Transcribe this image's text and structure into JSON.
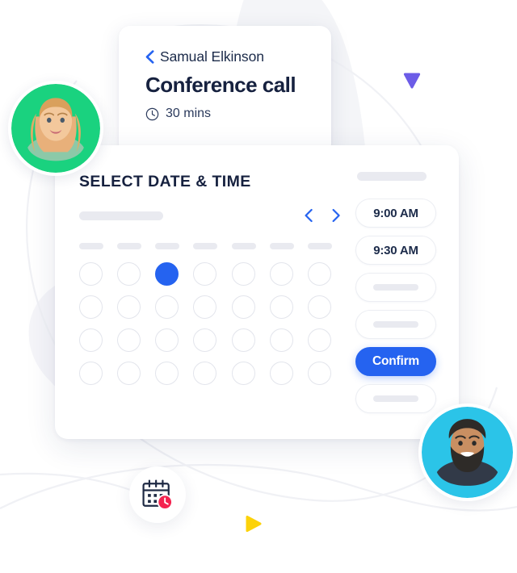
{
  "meeting": {
    "back_icon": "chevron-left-icon",
    "host_name": "Samual Elkinson",
    "title": "Conference call",
    "clock_icon": "clock-icon",
    "duration": "30 mins"
  },
  "picker": {
    "heading": "SELECT DATE & TIME",
    "calendar": {
      "month_label": "",
      "prev_icon": "chevron-left-icon",
      "next_icon": "chevron-right-icon",
      "weekday_count": 7,
      "rows": 4,
      "selected_row": 0,
      "selected_col": 2,
      "last_row_visible_cols": 7
    },
    "slots": [
      {
        "label": "9:00 AM",
        "style": "text",
        "selected": false
      },
      {
        "label": "9:30 AM",
        "style": "text",
        "selected": false
      },
      {
        "label": "",
        "style": "skeleton",
        "selected": false
      },
      {
        "label": "",
        "style": "skeleton",
        "selected": false
      },
      {
        "label": "Confirm",
        "style": "primary",
        "selected": true
      },
      {
        "label": "",
        "style": "skeleton",
        "selected": false
      }
    ]
  },
  "decor": {
    "avatar_left": {
      "name": "avatar-woman",
      "bg": "#1ad27f"
    },
    "avatar_right": {
      "name": "avatar-man",
      "bg": "#2bc4e8"
    },
    "calendar_badge_icon": "calendar-clock-icon",
    "triangle_purple": "#6c5ce7",
    "triangle_yellow": "#fcd20a",
    "accent_blue": "#2563f0",
    "skeleton_gray": "#e9eaf0",
    "text_dark": "#16213f"
  }
}
